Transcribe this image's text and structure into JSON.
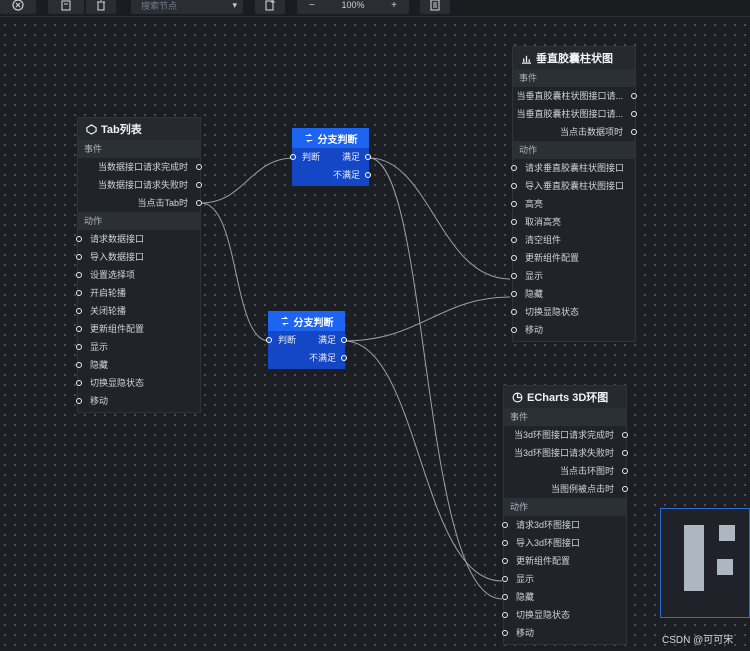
{
  "toolbar": {
    "search_placeholder": "搜索节点",
    "zoom_value": "100%",
    "zoom_out": "−",
    "zoom_in": "+"
  },
  "nodes": {
    "tab_list": {
      "title": "Tab列表",
      "events_label": "事件",
      "events": [
        "当数据接口请求完成时",
        "当数据接口请求失败时",
        "当点击Tab时"
      ],
      "actions_label": "动作",
      "actions": [
        "请求数据接口",
        "导入数据接口",
        "设置选择项",
        "开启轮播",
        "关闭轮播",
        "更新组件配置",
        "显示",
        "隐藏",
        "切换显隐状态",
        "移动"
      ]
    },
    "branch1": {
      "title": "分支判断",
      "input": "判断",
      "true_label": "满足",
      "false_label": "不满足"
    },
    "branch2": {
      "title": "分支判断",
      "input": "判断",
      "true_label": "满足",
      "false_label": "不满足"
    },
    "bar_chart": {
      "title": "垂直胶囊柱状图",
      "events_label": "事件",
      "events": [
        "当垂直胶囊柱状图接口请...",
        "当垂直胶囊柱状图接口请...",
        "当点击数据项时"
      ],
      "actions_label": "动作",
      "actions": [
        "请求垂直胶囊柱状图接口",
        "导入垂直胶囊柱状图接口",
        "高亮",
        "取消高亮",
        "清空组件",
        "更新组件配置",
        "显示",
        "隐藏",
        "切换显隐状态",
        "移动"
      ]
    },
    "echarts": {
      "title": "ECharts 3D环图",
      "events_label": "事件",
      "events": [
        "当3d环图接口请求完成时",
        "当3d环图接口请求失败时",
        "当点击环图时",
        "当图例被点击时"
      ],
      "actions_label": "动作",
      "actions": [
        "请求3d环图接口",
        "导入3d环图接口",
        "更新组件配置",
        "显示",
        "隐藏",
        "切换显隐状态",
        "移动"
      ]
    }
  },
  "watermark": "CSDN @可可宋"
}
